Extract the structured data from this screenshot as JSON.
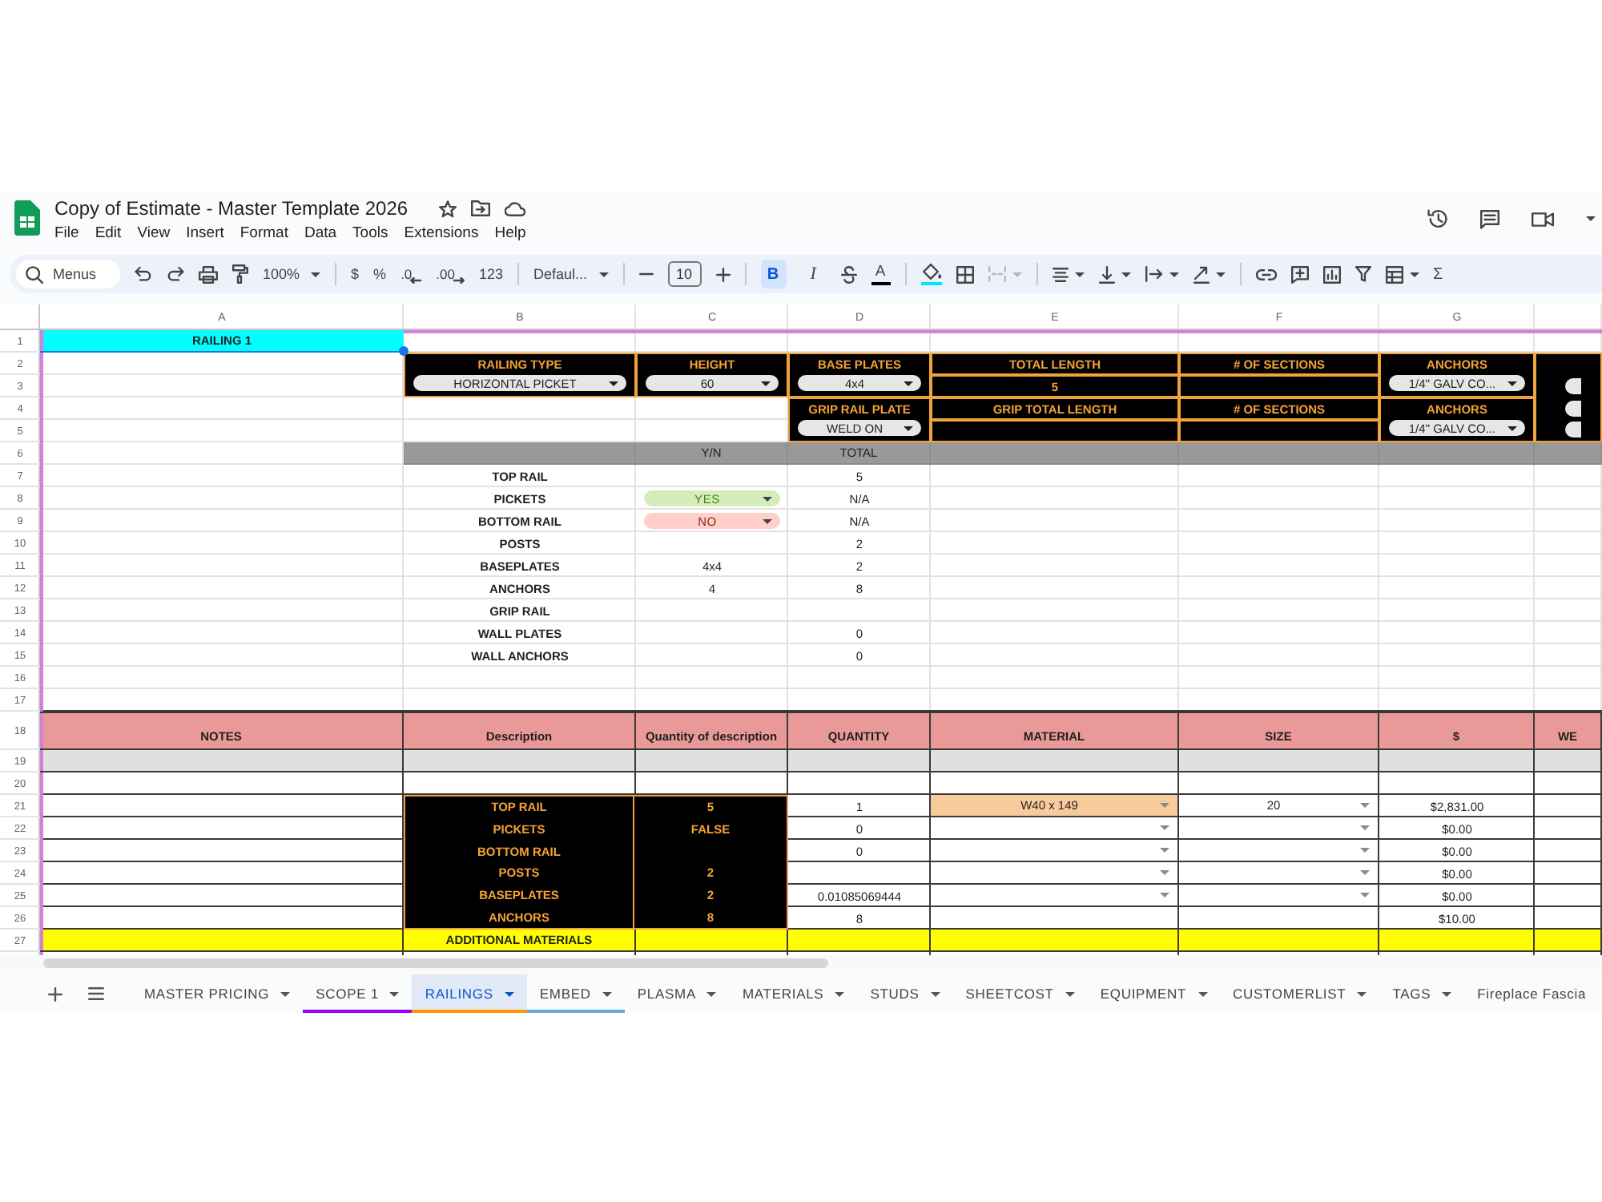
{
  "header": {
    "title": "Copy of Estimate - Master Template 2026",
    "menu": [
      "File",
      "Edit",
      "View",
      "Insert",
      "Format",
      "Data",
      "Tools",
      "Extensions",
      "Help"
    ]
  },
  "toolbar": {
    "search": {
      "placeholder": "Menus"
    },
    "zoom": "100%",
    "number_formats": [
      {
        "kind": "plain",
        "label": "$"
      },
      {
        "kind": "plain",
        "label": "%"
      },
      {
        "kind": "decrease",
        "label": ".0"
      },
      {
        "kind": "increase",
        "label": ".00"
      },
      {
        "kind": "plain",
        "label": "123"
      }
    ],
    "font": "Defaul...",
    "font_size": "10",
    "text_styles": [
      {
        "kind": "bold",
        "label": "B",
        "selected": true
      },
      {
        "kind": "italic",
        "label": "I",
        "selected": false
      }
    ],
    "text_color": "A",
    "merge": {
      "disabled": true
    },
    "functions": "Σ"
  },
  "sheet": {
    "column_letters": [
      "A",
      "B",
      "C",
      "D",
      "E",
      "F",
      "G"
    ],
    "row_numbers": [
      "1",
      "2",
      "3",
      "4",
      "5",
      "6",
      "7",
      "8",
      "9",
      "10",
      "11",
      "12",
      "13",
      "14",
      "15",
      "16",
      "17",
      "18",
      "19",
      "20",
      "21",
      "22",
      "23",
      "24",
      "25",
      "26",
      "27"
    ],
    "title_cell": "RAILING 1",
    "specs_top": [
      {
        "kind": "dropdown",
        "label": "RAILING TYPE",
        "value": "HORIZONTAL PICKET"
      },
      {
        "kind": "dropdown",
        "label": "HEIGHT",
        "value": "60"
      },
      {
        "kind": "dropdown",
        "label": "BASE PLATES",
        "value": "4x4"
      },
      {
        "kind": "entry",
        "label": "TOTAL LENGTH",
        "value": "5"
      },
      {
        "kind": "entry",
        "label": "# OF SECTIONS"
      },
      {
        "kind": "dropdown",
        "label": "ANCHORS",
        "value": "1/4\" GALV CO..."
      }
    ],
    "specs_bottom": [
      {
        "kind": "dropdown",
        "label": "GRIP RAIL PLATE",
        "value": "WELD ON"
      },
      {
        "kind": "entry",
        "label": "GRIP TOTAL LENGTH"
      },
      {
        "kind": "entry",
        "label": "# OF SECTIONS"
      },
      {
        "kind": "dropdown",
        "label": "ANCHORS",
        "value": "1/4\" GALV CO..."
      }
    ],
    "checklist": {
      "columns": [
        "Y/N",
        "TOTAL"
      ],
      "rows": [
        {
          "item": "TOP RAIL",
          "total": "5"
        },
        {
          "item": "PICKETS",
          "choice": {
            "value": "YES",
            "color": "#d4edbc"
          },
          "total": "N/A"
        },
        {
          "item": "BOTTOM RAIL",
          "choice": {
            "value": "NO",
            "color": "#ffcfc9"
          },
          "total": "N/A"
        },
        {
          "item": "POSTS",
          "total": "2"
        },
        {
          "item": "BASEPLATES",
          "value": "4x4",
          "total": "2"
        },
        {
          "item": "ANCHORS",
          "value": "4",
          "total": "8"
        },
        {
          "item": "GRIP RAIL"
        },
        {
          "item": "WALL PLATES",
          "total": "0"
        },
        {
          "item": "WALL ANCHORS",
          "total": "0"
        }
      ]
    },
    "materials": {
      "columns": [
        "NOTES",
        "Description",
        "Quantity of description",
        "QUANTITY",
        "MATERIAL",
        "SIZE",
        "$",
        "WE"
      ],
      "rows": [
        {
          "description": "TOP RAIL",
          "description_qty": "5",
          "quantity": "1",
          "material": {
            "dropdown": true,
            "value": "W40 x 149",
            "color": "#f9cb9c"
          },
          "size": {
            "dropdown": true,
            "value": "20"
          },
          "price": "$2,831.00"
        },
        {
          "description": "PICKETS",
          "description_qty": "FALSE",
          "quantity": "0",
          "material": {
            "dropdown": true
          },
          "size": {
            "dropdown": true
          },
          "price": "$0.00"
        },
        {
          "description": "BOTTOM RAIL",
          "quantity": "0",
          "material": {
            "dropdown": true
          },
          "size": {
            "dropdown": true
          },
          "price": "$0.00"
        },
        {
          "description": "POSTS",
          "description_qty": "2",
          "material": {
            "dropdown": true
          },
          "size": {
            "dropdown": true
          },
          "price": "$0.00"
        },
        {
          "description": "BASEPLATES",
          "description_qty": "2",
          "quantity": "0.01085069444",
          "material": {
            "dropdown": true
          },
          "size": {
            "dropdown": true
          },
          "price": "$0.00"
        },
        {
          "description": "ANCHORS",
          "description_qty": "8",
          "quantity": "8",
          "price": "$10.00"
        }
      ],
      "section": "ADDITIONAL MATERIALS"
    }
  },
  "sheet_tabs": [
    {
      "label": "MASTER PRICING",
      "selected": false,
      "menu": true
    },
    {
      "label": "SCOPE 1",
      "selected": false,
      "menu": true,
      "color": "#9900ff"
    },
    {
      "label": "RAILINGS",
      "selected": true,
      "menu": true,
      "color": "#ff9900"
    },
    {
      "label": "EMBED",
      "selected": false,
      "menu": true,
      "color": "#6fa8dc"
    },
    {
      "label": "PLASMA",
      "selected": false,
      "menu": true
    },
    {
      "label": "MATERIALS",
      "selected": false,
      "menu": true
    },
    {
      "label": "STUDS",
      "selected": false,
      "menu": true
    },
    {
      "label": "SHEETCOST",
      "selected": false,
      "menu": true
    },
    {
      "label": "EQUIPMENT",
      "selected": false,
      "menu": true
    },
    {
      "label": "CUSTOMERLIST",
      "selected": false,
      "menu": true
    },
    {
      "label": "TAGS",
      "selected": false,
      "menu": true
    },
    {
      "label": "Fireplace Fascia",
      "selected": false,
      "menu": false
    }
  ]
}
